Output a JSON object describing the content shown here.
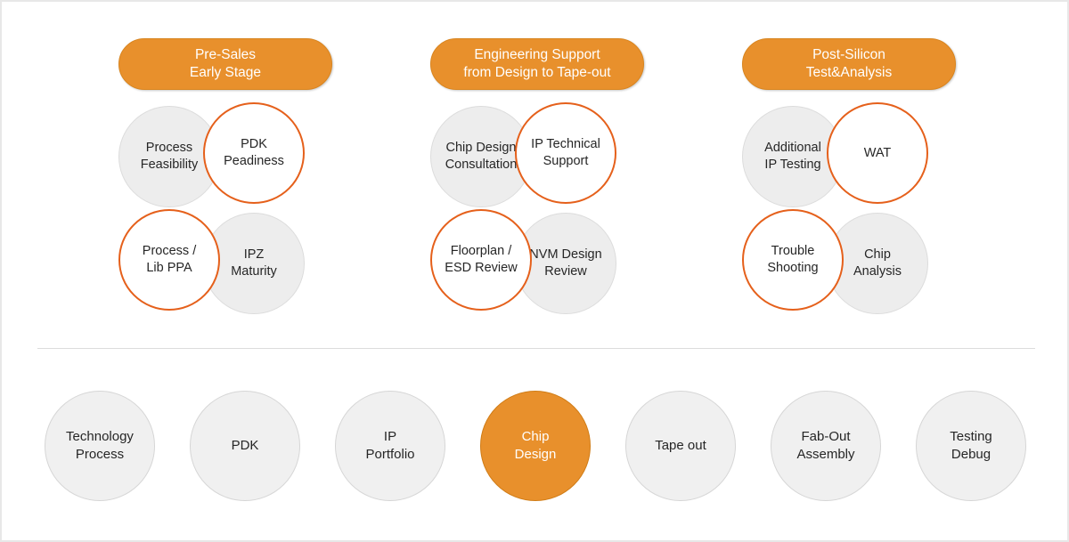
{
  "colors": {
    "pill_fill": "#e8902c",
    "bubble_outline_orange": "#e5601b",
    "bubble_gray_fill": "#ededed",
    "flow_gray_fill": "#f0f0f0",
    "flow_active_fill": "#e8902c",
    "text_dark": "#262626",
    "divider": "#dcdcdc"
  },
  "groups": [
    {
      "id": "pre-sales",
      "title_line1": "Pre-Sales",
      "title_line2": "Early Stage",
      "bubbles": [
        {
          "pos": "top-left",
          "style": "gray",
          "line1": "Process",
          "line2": "Feasibility"
        },
        {
          "pos": "top-right",
          "style": "orange",
          "line1": "PDK",
          "line2": "Peadiness"
        },
        {
          "pos": "bottom-left",
          "style": "orange",
          "line1": "Process /",
          "line2": "Lib PPA"
        },
        {
          "pos": "bottom-right",
          "style": "gray",
          "line1": "IPZ",
          "line2": "Maturity"
        }
      ]
    },
    {
      "id": "engineering-support",
      "title_line1": "Engineering Support",
      "title_line2": "from Design to Tape-out",
      "bubbles": [
        {
          "pos": "top-left",
          "style": "gray",
          "line1": "Chip Design",
          "line2": "Consultation"
        },
        {
          "pos": "top-right",
          "style": "orange",
          "line1": "IP Technical",
          "line2": "Support"
        },
        {
          "pos": "bottom-left",
          "style": "orange",
          "line1": "Floorplan /",
          "line2": "ESD Review"
        },
        {
          "pos": "bottom-right",
          "style": "gray",
          "line1": "NVM Design",
          "line2": "Review"
        }
      ]
    },
    {
      "id": "post-silicon",
      "title_line1": "Post-Silicon",
      "title_line2": "Test&Analysis",
      "bubbles": [
        {
          "pos": "top-left",
          "style": "gray",
          "line1": "Additional",
          "line2": "IP Testing"
        },
        {
          "pos": "top-right",
          "style": "orange",
          "line1": "WAT",
          "line2": ""
        },
        {
          "pos": "bottom-left",
          "style": "orange",
          "line1": "Trouble",
          "line2": "Shooting"
        },
        {
          "pos": "bottom-right",
          "style": "gray",
          "line1": "Chip",
          "line2": "Analysis"
        }
      ]
    }
  ],
  "flow": {
    "steps": [
      {
        "line1": "Technology",
        "line2": "Process",
        "active": false,
        "arrow": true
      },
      {
        "line1": "PDK",
        "line2": "",
        "active": false,
        "arrow": true
      },
      {
        "line1": "IP",
        "line2": "Portfolio",
        "active": false,
        "arrow": true
      },
      {
        "line1": "Chip",
        "line2": "Design",
        "active": true,
        "arrow": true
      },
      {
        "line1": "Tape out",
        "line2": "",
        "active": false,
        "arrow": true
      },
      {
        "line1": "Fab-Out",
        "line2": "Assembly",
        "active": false,
        "arrow": true
      },
      {
        "line1": "Testing",
        "line2": "Debug",
        "active": false,
        "arrow": false
      }
    ]
  }
}
